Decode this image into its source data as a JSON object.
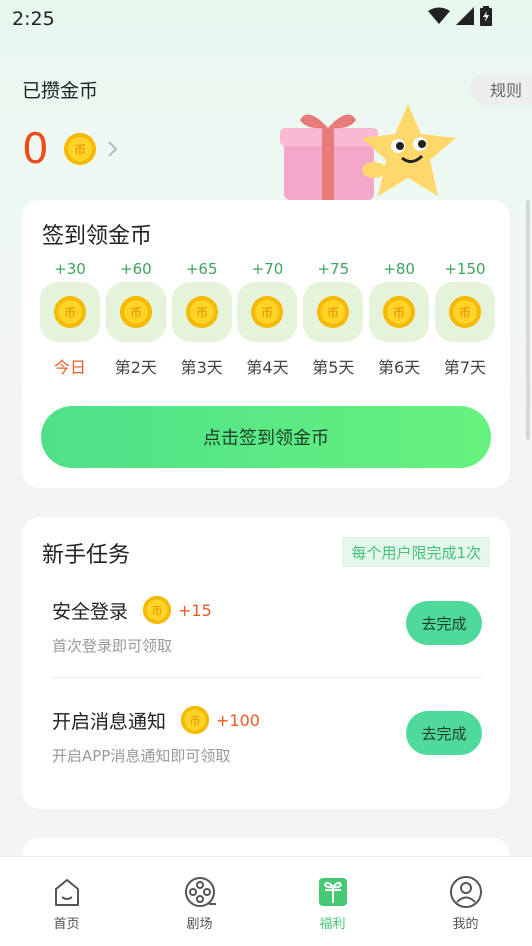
{
  "status_bar": {
    "time": "2:25"
  },
  "header": {
    "coins_title": "已攒金币",
    "coin_count": "0",
    "rules_label": "规则"
  },
  "signin": {
    "title": "签到领金币",
    "days": [
      {
        "reward": "+30",
        "label": "今日"
      },
      {
        "reward": "+60",
        "label": "第2天"
      },
      {
        "reward": "+65",
        "label": "第3天"
      },
      {
        "reward": "+70",
        "label": "第4天"
      },
      {
        "reward": "+75",
        "label": "第5天"
      },
      {
        "reward": "+80",
        "label": "第6天"
      },
      {
        "reward": "+150",
        "label": "第7天"
      }
    ],
    "button_label": "点击签到领金币"
  },
  "tasks": {
    "title": "新手任务",
    "limit_badge": "每个用户限完成1次",
    "items": [
      {
        "name": "安全登录",
        "reward": "+15",
        "desc": "首次登录即可领取",
        "button": "去完成"
      },
      {
        "name": "开启消息通知",
        "reward": "+100",
        "desc": "开启APP消息通知即可领取",
        "button": "去完成"
      }
    ]
  },
  "tab_bar": {
    "items": [
      {
        "label": "首页",
        "icon": "home-icon"
      },
      {
        "label": "剧场",
        "icon": "film-reel-icon"
      },
      {
        "label": "福利",
        "icon": "gift-icon",
        "active": true
      },
      {
        "label": "我的",
        "icon": "profile-icon"
      }
    ]
  },
  "colors": {
    "accent_green": "#4fe08a",
    "coin_orange": "#f04a1d",
    "reward_green": "#3ea45a",
    "active_tab": "#45c974"
  },
  "coin_glyph": "币"
}
